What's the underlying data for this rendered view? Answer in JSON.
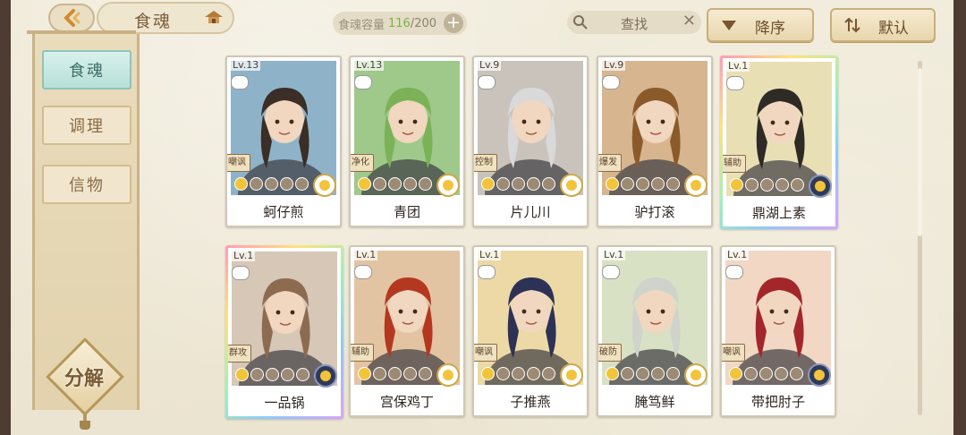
{
  "header": {
    "title": "食魂",
    "capacity_label": "食魂容量",
    "capacity_current": "116",
    "capacity_max": "/200",
    "search_label": "查找",
    "sort_desc_label": "降序",
    "sort_default_label": "默认"
  },
  "sidebar": {
    "items": [
      {
        "label": "食魂",
        "active": true
      },
      {
        "label": "调理",
        "active": false
      },
      {
        "label": "信物",
        "active": false
      }
    ],
    "decompose_label": "分解"
  },
  "cards": [
    {
      "level": "Lv.13",
      "role": "嘲讽",
      "stars": 1,
      "name": "蚵仔煎",
      "bg": "#8eb3c8",
      "hair": "#3a2e26",
      "element": "gold"
    },
    {
      "level": "Lv.13",
      "role": "净化",
      "stars": 1,
      "name": "青团",
      "bg": "#9fc98a",
      "hair": "#7bb258",
      "element": "gold"
    },
    {
      "level": "Lv.9",
      "role": "控制",
      "stars": 1,
      "name": "片儿川",
      "bg": "#c9c3bb",
      "hair": "#d9d9d9",
      "element": "gold"
    },
    {
      "level": "Lv.9",
      "role": "爆发",
      "stars": 1,
      "name": "驴打滚",
      "bg": "#d7b58f",
      "hair": "#8b5a2b",
      "element": "gold"
    },
    {
      "level": "Lv.1",
      "role": "辅助",
      "stars": 1,
      "name": "鼎湖上素",
      "bg": "#e9dfb5",
      "hair": "#2e2a26",
      "element": "dark",
      "rainbow": true
    },
    {
      "level": "Lv.1",
      "role": "群攻",
      "stars": 1,
      "name": "一品锅",
      "bg": "#d6c7b6",
      "hair": "#8c6b50",
      "element": "dark",
      "rainbow": true
    },
    {
      "level": "Lv.1",
      "role": "辅助",
      "stars": 1,
      "name": "宫保鸡丁",
      "bg": "#e3c4a2",
      "hair": "#b3381f",
      "element": "gold"
    },
    {
      "level": "Lv.1",
      "role": "嘲讽",
      "stars": 1,
      "name": "子推燕",
      "bg": "#ecd9a6",
      "hair": "#2d3155",
      "element": "gold"
    },
    {
      "level": "Lv.1",
      "role": "破防",
      "stars": 1,
      "name": "腌笃鲜",
      "bg": "#d9e1c4",
      "hair": "#cfd3cc",
      "element": "gold"
    },
    {
      "level": "Lv.1",
      "role": "嘲讽",
      "stars": 1,
      "name": "带把肘子",
      "bg": "#f1d7c4",
      "hair": "#a3262a",
      "element": "dark"
    }
  ]
}
